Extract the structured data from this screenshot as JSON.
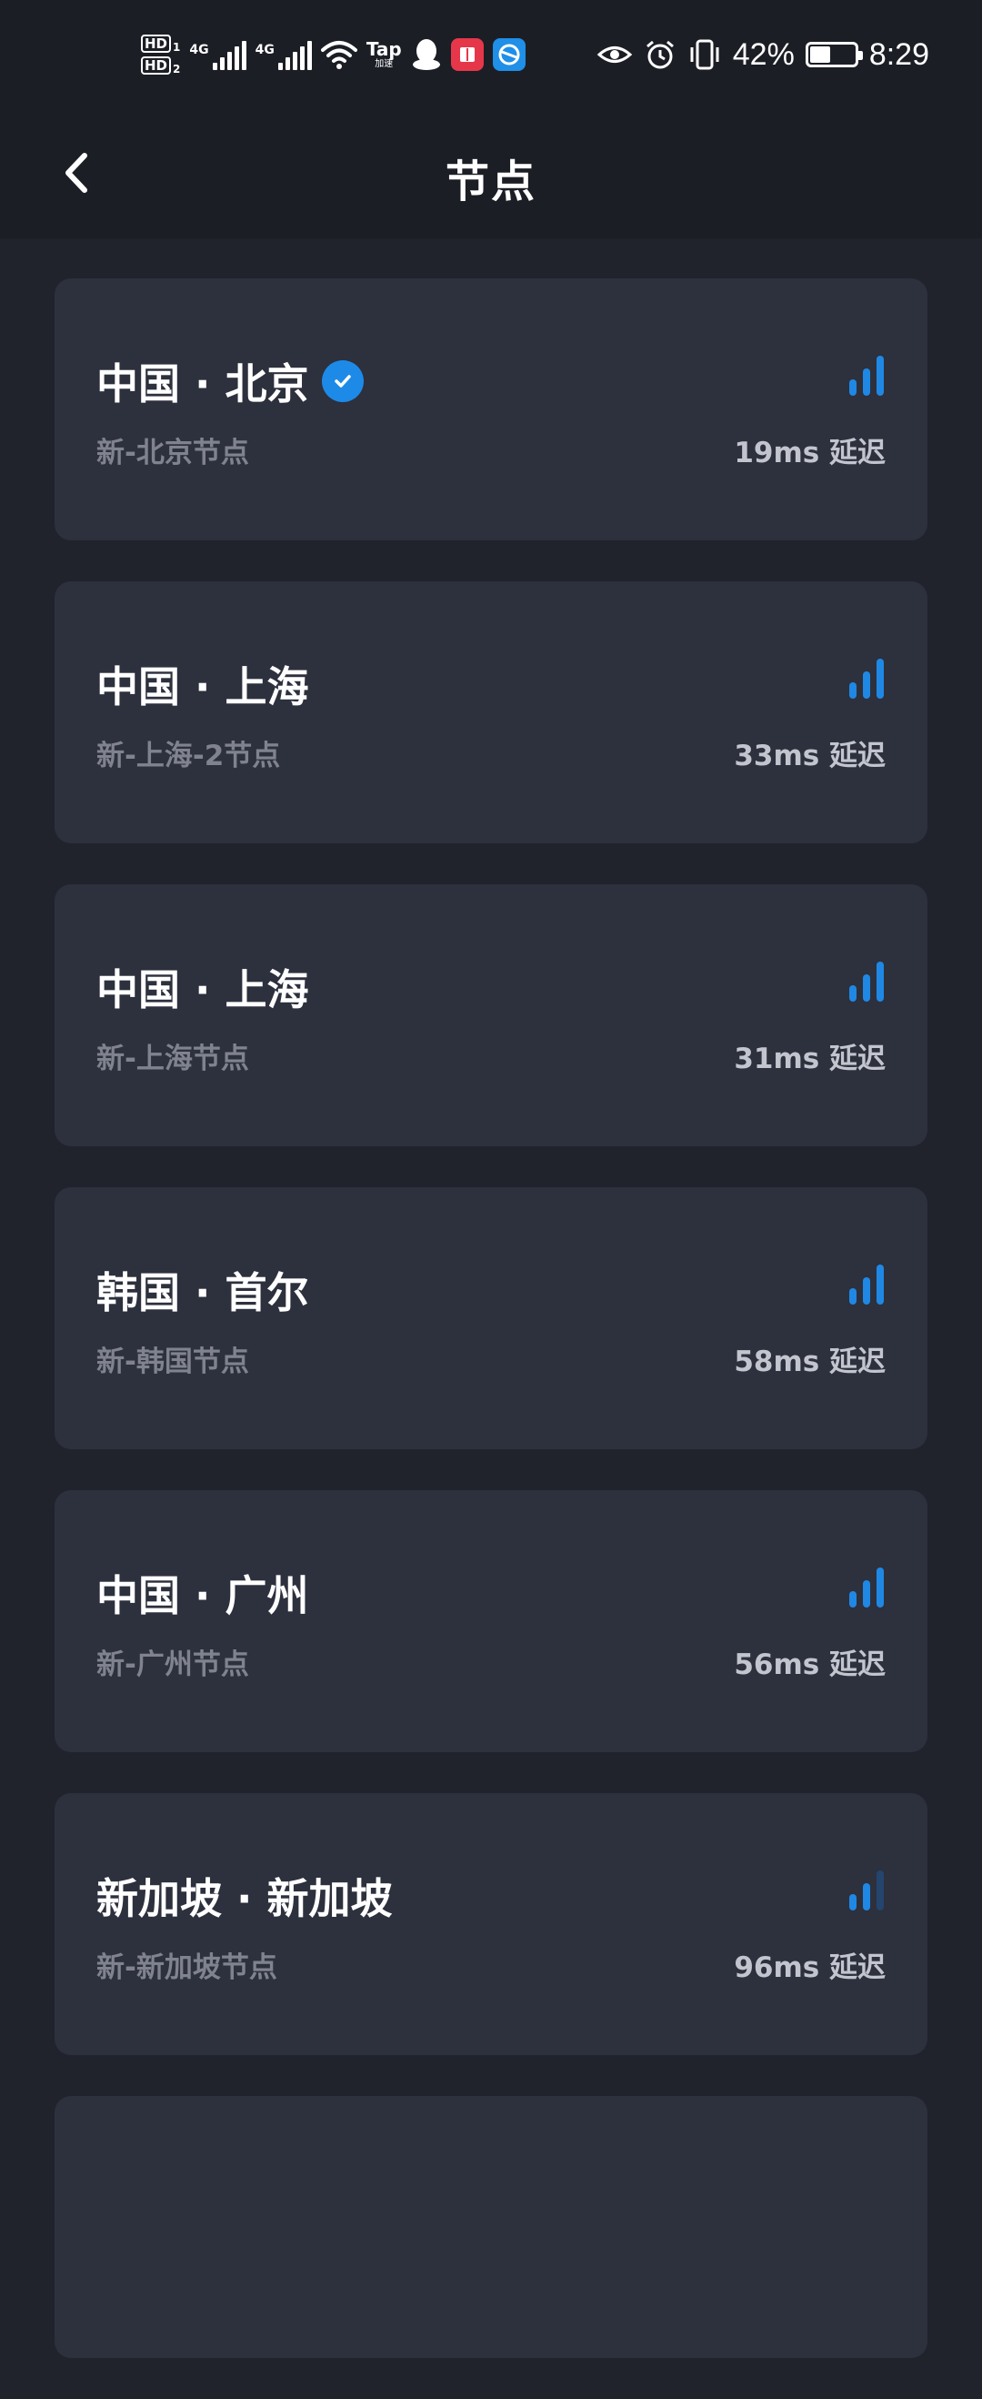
{
  "status_bar": {
    "sim1_label": "HD",
    "sim1_index": "1",
    "sim2_label": "HD",
    "sim2_index": "2",
    "net1": "4G",
    "net2": "4G",
    "tap_label": "Tap",
    "tap_sub": "加速",
    "battery": "42%",
    "battery_level": 0.42,
    "time": "8:29"
  },
  "header": {
    "title": "节点",
    "back_icon": "chevron-left-icon"
  },
  "colors": {
    "background": "#21232c",
    "card": "#2d303d",
    "accent": "#1f88e5",
    "subtext": "#80838f"
  },
  "nodes": [
    {
      "name": "中国 · 北京",
      "subtitle": "新-北京节点",
      "latency": "19ms 延迟",
      "selected": true,
      "signal_level": 3
    },
    {
      "name": "中国 · 上海",
      "subtitle": "新-上海-2节点",
      "latency": "33ms 延迟",
      "selected": false,
      "signal_level": 3
    },
    {
      "name": "中国 · 上海",
      "subtitle": "新-上海节点",
      "latency": "31ms 延迟",
      "selected": false,
      "signal_level": 3
    },
    {
      "name": "韩国 · 首尔",
      "subtitle": "新-韩国节点",
      "latency": "58ms 延迟",
      "selected": false,
      "signal_level": 3
    },
    {
      "name": "中国 · 广州",
      "subtitle": "新-广州节点",
      "latency": "56ms 延迟",
      "selected": false,
      "signal_level": 3
    },
    {
      "name": "新加坡 · 新加坡",
      "subtitle": "新-新加坡节点",
      "latency": "96ms 延迟",
      "selected": false,
      "signal_level": 2
    }
  ]
}
